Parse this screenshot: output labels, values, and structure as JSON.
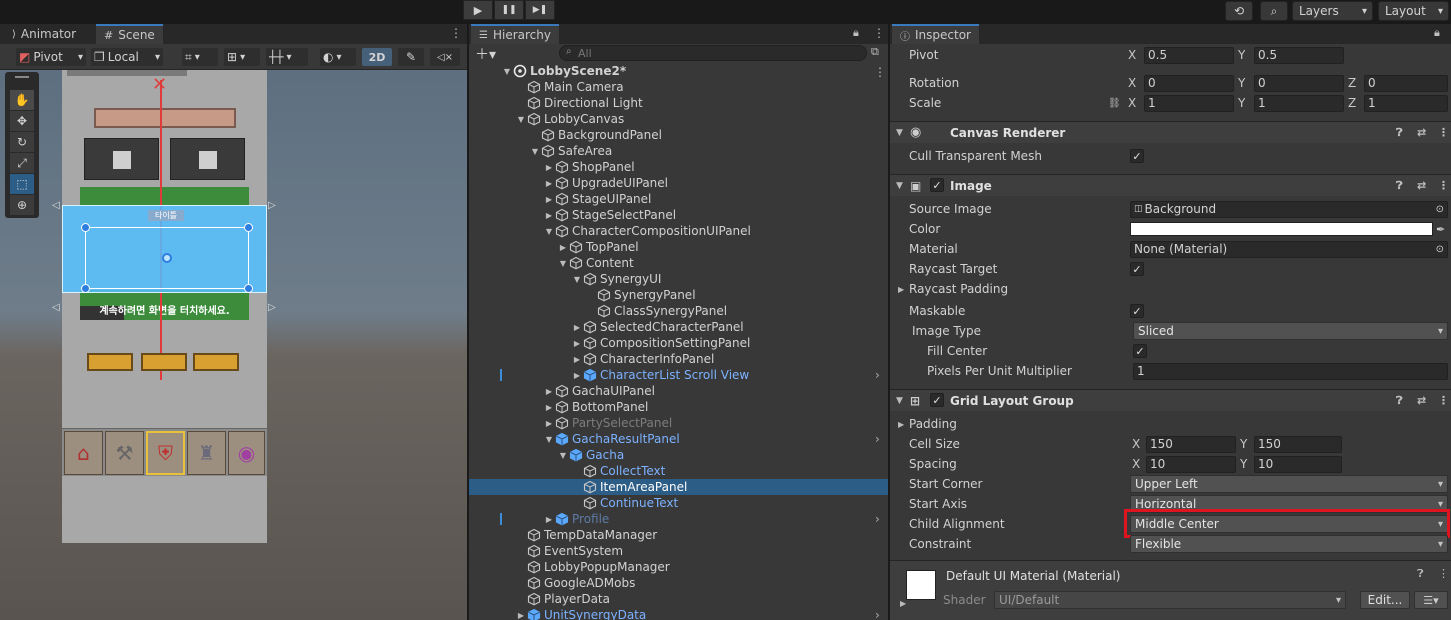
{
  "toolbar": {
    "layers_label": "Layers",
    "layout_label": "Layout",
    "play_glyph": "▶",
    "pause_glyph": "❚❚",
    "step_glyph": "▶❚"
  },
  "scene_panel": {
    "tabs": [
      {
        "label": "Animator"
      },
      {
        "label": "Scene"
      }
    ],
    "pivot_label": "Pivot",
    "local_label": "Local",
    "mode_2d_label": "2D",
    "title_text": "타이틀",
    "tap_text": "계속하려면 화면을 터치하세요."
  },
  "hierarchy": {
    "tab_label": "Hierarchy",
    "search_placeholder": "All",
    "rows": [
      {
        "label": "LobbyScene2*",
        "depth": 0,
        "arrow": "▼",
        "style": "scene"
      },
      {
        "label": "Main Camera",
        "depth": 1,
        "arrow": "",
        "style": "normal"
      },
      {
        "label": "Directional Light",
        "depth": 1,
        "arrow": "",
        "style": "normal"
      },
      {
        "label": "LobbyCanvas",
        "depth": 1,
        "arrow": "▼",
        "style": "normal"
      },
      {
        "label": "BackgroundPanel",
        "depth": 2,
        "arrow": "",
        "style": "normal"
      },
      {
        "label": "SafeArea",
        "depth": 2,
        "arrow": "▼",
        "style": "normal"
      },
      {
        "label": "ShopPanel",
        "depth": 3,
        "arrow": "▶",
        "style": "normal"
      },
      {
        "label": "UpgradeUIPanel",
        "depth": 3,
        "arrow": "▶",
        "style": "normal"
      },
      {
        "label": "StageUIPanel",
        "depth": 3,
        "arrow": "▶",
        "style": "normal"
      },
      {
        "label": "StageSelectPanel",
        "depth": 3,
        "arrow": "▶",
        "style": "normal"
      },
      {
        "label": "CharacterCompositionUIPanel",
        "depth": 3,
        "arrow": "▼",
        "style": "normal"
      },
      {
        "label": "TopPanel",
        "depth": 4,
        "arrow": "▶",
        "style": "normal"
      },
      {
        "label": "Content",
        "depth": 4,
        "arrow": "▼",
        "style": "normal"
      },
      {
        "label": "SynergyUI",
        "depth": 5,
        "arrow": "▼",
        "style": "normal"
      },
      {
        "label": "SynergyPanel",
        "depth": 6,
        "arrow": "",
        "style": "normal"
      },
      {
        "label": "ClassSynergyPanel",
        "depth": 6,
        "arrow": "",
        "style": "normal"
      },
      {
        "label": "SelectedCharacterPanel",
        "depth": 5,
        "arrow": "▶",
        "style": "normal"
      },
      {
        "label": "CompositionSettingPanel",
        "depth": 5,
        "arrow": "▶",
        "style": "normal"
      },
      {
        "label": "CharacterInfoPanel",
        "depth": 5,
        "arrow": "▶",
        "style": "normal"
      },
      {
        "label": "CharacterList Scroll View",
        "depth": 5,
        "arrow": "▶",
        "style": "prefab"
      },
      {
        "label": "GachaUIPanel",
        "depth": 3,
        "arrow": "▶",
        "style": "normal"
      },
      {
        "label": "BottomPanel",
        "depth": 3,
        "arrow": "▶",
        "style": "normal"
      },
      {
        "label": "PartySelectPanel",
        "depth": 3,
        "arrow": "▶",
        "style": "inactive"
      },
      {
        "label": "GachaResultPanel",
        "depth": 3,
        "arrow": "▼",
        "style": "prefab"
      },
      {
        "label": "Gacha",
        "depth": 4,
        "arrow": "▼",
        "style": "prefab"
      },
      {
        "label": "CollectText",
        "depth": 5,
        "arrow": "",
        "style": "prefab"
      },
      {
        "label": "ItemAreaPanel",
        "depth": 5,
        "arrow": "",
        "style": "selected"
      },
      {
        "label": "ContinueText",
        "depth": 5,
        "arrow": "",
        "style": "prefab"
      },
      {
        "label": "Profile",
        "depth": 3,
        "arrow": "▶",
        "style": "prefab-inactive"
      },
      {
        "label": "TempDataManager",
        "depth": 1,
        "arrow": "",
        "style": "normal"
      },
      {
        "label": "EventSystem",
        "depth": 1,
        "arrow": "",
        "style": "normal"
      },
      {
        "label": "LobbyPopupManager",
        "depth": 1,
        "arrow": "",
        "style": "normal"
      },
      {
        "label": "GoogleADMobs",
        "depth": 1,
        "arrow": "",
        "style": "normal"
      },
      {
        "label": "PlayerData",
        "depth": 1,
        "arrow": "",
        "style": "normal"
      },
      {
        "label": "UnitSynergyData",
        "depth": 1,
        "arrow": "▶",
        "style": "prefab"
      }
    ]
  },
  "inspector": {
    "tab_label": "Inspector",
    "pivot": {
      "label": "Pivot",
      "x": "0.5",
      "y": "0.5"
    },
    "rotation": {
      "label": "Rotation",
      "x": "0",
      "y": "0",
      "z": "0"
    },
    "scale": {
      "label": "Scale",
      "x": "1",
      "y": "1",
      "z": "1"
    },
    "axis_x": "X",
    "axis_y": "Y",
    "axis_z": "Z",
    "canvas_renderer": {
      "title": "Canvas Renderer",
      "cull_label": "Cull Transparent Mesh"
    },
    "image": {
      "title": "Image",
      "source_image_label": "Source Image",
      "source_image_value": "Background",
      "color_label": "Color",
      "color_value": "#ffffff",
      "material_label": "Material",
      "material_value": "None (Material)",
      "raycast_target_label": "Raycast Target",
      "raycast_padding_label": "Raycast Padding",
      "maskable_label": "Maskable",
      "image_type_label": "Image Type",
      "image_type_value": "Sliced",
      "fill_center_label": "Fill Center",
      "ppu_label": "Pixels Per Unit Multiplier",
      "ppu_value": "1"
    },
    "grid": {
      "title": "Grid Layout Group",
      "padding_label": "Padding",
      "cell_size_label": "Cell Size",
      "cell_x": "150",
      "cell_y": "150",
      "spacing_label": "Spacing",
      "spacing_x": "10",
      "spacing_y": "10",
      "start_corner_label": "Start Corner",
      "start_corner_value": "Upper Left",
      "start_axis_label": "Start Axis",
      "start_axis_value": "Horizontal",
      "child_alignment_label": "Child Alignment",
      "child_alignment_value": "Middle Center",
      "constraint_label": "Constraint",
      "constraint_value": "Flexible"
    },
    "material": {
      "title": "Default UI Material (Material)",
      "shader_label": "Shader",
      "shader_value": "UI/Default",
      "edit_label": "Edit..."
    },
    "highlight_color": "#e0141e"
  }
}
